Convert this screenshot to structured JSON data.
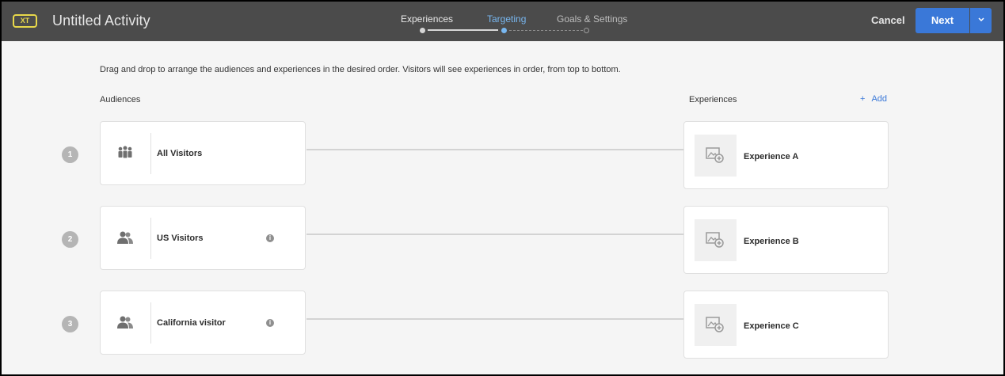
{
  "header": {
    "badge": "XT",
    "title": "Untitled Activity",
    "steps": [
      {
        "label": "Experiences",
        "state": "done"
      },
      {
        "label": "Targeting",
        "state": "current"
      },
      {
        "label": "Goals & Settings",
        "state": "todo"
      }
    ],
    "cancel_label": "Cancel",
    "next_label": "Next",
    "next_dropdown_icon": "chevron-down-icon"
  },
  "main": {
    "instructions": "Drag and drop to arrange the audiences and experiences in the desired order. Visitors will see experiences in order, from top to bottom.",
    "audiences_heading": "Audiences",
    "experiences_heading": "Experiences",
    "add_label": "Add",
    "add_icon": "plus-icon",
    "rows": [
      {
        "number": "1",
        "audience": "All Visitors",
        "audience_icon": "group-icon",
        "info": false,
        "experience": "Experience A"
      },
      {
        "number": "2",
        "audience": "US Visitors",
        "audience_icon": "users-icon",
        "info": true,
        "experience": "Experience B"
      },
      {
        "number": "3",
        "audience": "California visitor",
        "audience_icon": "users-icon",
        "info": true,
        "experience": "Experience C"
      }
    ]
  },
  "colors": {
    "topbar": "#4b4b4b",
    "accent": "#3a78d8",
    "current_step": "#78b7f0",
    "badge": "#e8d84a",
    "background": "#f5f5f5"
  }
}
